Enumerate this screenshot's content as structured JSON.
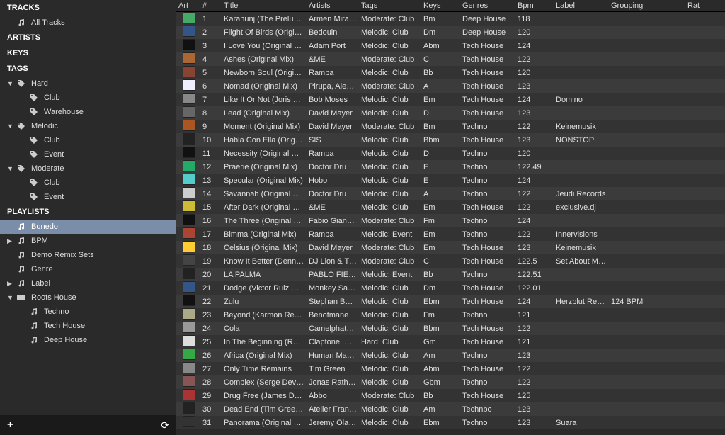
{
  "sidebar": {
    "sections": {
      "tracks": {
        "label": "TRACKS",
        "allTracks": "All Tracks"
      },
      "artists": {
        "label": "ARTISTS"
      },
      "keys": {
        "label": "KEYS"
      },
      "tags": {
        "label": "TAGS",
        "hard": {
          "label": "Hard",
          "club": "Club",
          "warehouse": "Warehouse"
        },
        "melodic": {
          "label": "Melodic",
          "club": "Club",
          "event": "Event"
        },
        "moderate": {
          "label": "Moderate",
          "club": "Club",
          "event": "Event"
        }
      },
      "playlists": {
        "label": "PLAYLISTS",
        "bonedo": "Bonedo",
        "bpm": "BPM",
        "demoRemix": "Demo Remix Sets",
        "genre": "Genre",
        "labelPL": "Label",
        "rootsHouse": {
          "label": "Roots House",
          "techno": "Techno",
          "techHouse": "Tech House",
          "deepHouse": "Deep House"
        }
      }
    }
  },
  "columns": {
    "art": "Art",
    "num": "#",
    "title": "Title",
    "artists": "Artists",
    "tags": "Tags",
    "keys": "Keys",
    "genres": "Genres",
    "bpm": "Bpm",
    "label": "Label",
    "grouping": "Grouping",
    "rat": "Rat"
  },
  "rows": [
    {
      "n": "1",
      "title": "Karahunj (The Prelude)",
      "artist": "Armen Mira…",
      "tag": "Moderate: Club",
      "key": "Bm",
      "genre": "Deep House",
      "bpm": "118",
      "label": "",
      "grouping": ""
    },
    {
      "n": "2",
      "title": "Flight Of Birds (Original…",
      "artist": "Bedouin",
      "tag": "Melodic: Club",
      "key": "Dm",
      "genre": "Deep House",
      "bpm": "120",
      "label": "",
      "grouping": ""
    },
    {
      "n": "3",
      "title": "I Love You (Original Mix)",
      "artist": "Adam Port",
      "tag": "Melodic: Club",
      "key": "Abm",
      "genre": "Tech House",
      "bpm": "124",
      "label": "",
      "grouping": ""
    },
    {
      "n": "4",
      "title": "Ashes (Original Mix)",
      "artist": "&ME",
      "tag": "Moderate: Club",
      "key": "C",
      "genre": "Tech House",
      "bpm": "122",
      "label": "",
      "grouping": ""
    },
    {
      "n": "5",
      "title": "Newborn Soul (Original…",
      "artist": "Rampa",
      "tag": "Melodic: Club",
      "key": "Bb",
      "genre": "Tech House",
      "bpm": "120",
      "label": "",
      "grouping": ""
    },
    {
      "n": "6",
      "title": "Nomad (Original Mix)",
      "artist": "Pirupa, Alex…",
      "tag": "Moderate: Club",
      "key": "A",
      "genre": "Tech House",
      "bpm": "123",
      "label": "",
      "grouping": ""
    },
    {
      "n": "7",
      "title": "Like It Or Not (Joris Voor…",
      "artist": "Bob Moses",
      "tag": "Melodic: Club",
      "key": "Em",
      "genre": "Tech House",
      "bpm": "124",
      "label": "Domino",
      "grouping": ""
    },
    {
      "n": "8",
      "title": "Lead (Original Mix)",
      "artist": "David Mayer",
      "tag": "Melodic: Club",
      "key": "D",
      "genre": "Tech House",
      "bpm": "123",
      "label": "",
      "grouping": ""
    },
    {
      "n": "9",
      "title": "Moment (Original Mix)",
      "artist": "David Mayer",
      "tag": "Moderate: Club",
      "key": "Bm",
      "genre": "Techno",
      "bpm": "122",
      "label": "Keinemusik",
      "grouping": ""
    },
    {
      "n": "10",
      "title": "Habla Con Ella (Original…",
      "artist": "SIS",
      "tag": "Melodic: Club",
      "key": "Bbm",
      "genre": "Tech House",
      "bpm": "123",
      "label": "NONSTOP",
      "grouping": ""
    },
    {
      "n": "11",
      "title": "Necessity (Original Mix)",
      "artist": "Rampa",
      "tag": "Melodic: Club",
      "key": "D",
      "genre": "Techno",
      "bpm": "120",
      "label": "",
      "grouping": ""
    },
    {
      "n": "12",
      "title": "Praerie (Original Mix)",
      "artist": "Doctor Dru",
      "tag": "Melodic: Club",
      "key": "E",
      "genre": "Techno",
      "bpm": "122.49",
      "label": "",
      "grouping": ""
    },
    {
      "n": "13",
      "title": "Specular (Original Mix)",
      "artist": "Hobo",
      "tag": "Melodic: Club",
      "key": "E",
      "genre": "Techno",
      "bpm": "124",
      "label": "",
      "grouping": ""
    },
    {
      "n": "14",
      "title": "Savannah (Original Mix)",
      "artist": "Doctor Dru",
      "tag": "Melodic: Club",
      "key": "A",
      "genre": "Techno",
      "bpm": "122",
      "label": "Jeudi Records",
      "grouping": ""
    },
    {
      "n": "15",
      "title": "After Dark (Original Mix)",
      "artist": "&ME",
      "tag": "Melodic: Club",
      "key": "Em",
      "genre": "Tech House",
      "bpm": "122",
      "label": "exclusive.dj",
      "grouping": ""
    },
    {
      "n": "16",
      "title": "The Three (Original Mix)",
      "artist": "Fabio Giannelli",
      "tag": "Moderate: Club",
      "key": "Fm",
      "genre": "Techno",
      "bpm": "124",
      "label": "",
      "grouping": ""
    },
    {
      "n": "17",
      "title": "Bimma (Original Mix)",
      "artist": "Rampa",
      "tag": "Melodic: Event",
      "key": "Em",
      "genre": "Techno",
      "bpm": "122",
      "label": "Innervisions",
      "grouping": ""
    },
    {
      "n": "18",
      "title": "Celsius (Original Mix)",
      "artist": "David Mayer",
      "tag": "Moderate: Club",
      "key": "Em",
      "genre": "Tech House",
      "bpm": "123",
      "label": "Keinemusik",
      "grouping": ""
    },
    {
      "n": "19",
      "title": "Know It Better (Dennis C…",
      "artist": "DJ Lion & Tr…",
      "tag": "Moderate: Club",
      "key": "C",
      "genre": "Tech House",
      "bpm": "122.5",
      "label": "Set About Mu…",
      "grouping": ""
    },
    {
      "n": "20",
      "title": "LA PALMA",
      "artist": "PABLO FIER…",
      "tag": "Melodic: Event",
      "key": "Bb",
      "genre": "Techno",
      "bpm": "122.51",
      "label": "",
      "grouping": ""
    },
    {
      "n": "21",
      "title": "Dodge (Victor Ruiz Remix)",
      "artist": "Monkey Safari",
      "tag": "Melodic: Club",
      "key": "Dm",
      "genre": "Tech House",
      "bpm": "122.01",
      "label": "",
      "grouping": ""
    },
    {
      "n": "22",
      "title": "Zulu",
      "artist": "Stephan Bo…",
      "tag": "Melodic: Club",
      "key": "Ebm",
      "genre": "Tech House",
      "bpm": "124",
      "label": "Herzblut Rec…",
      "grouping": "124 BPM"
    },
    {
      "n": "23",
      "title": "Beyond (Karmon Remix)",
      "artist": "Benotmane",
      "tag": "Melodic: Club",
      "key": "Fm",
      "genre": "Techno",
      "bpm": "121",
      "label": "",
      "grouping": ""
    },
    {
      "n": "24",
      "title": "Cola",
      "artist": "Camelphat…",
      "tag": "Melodic: Club",
      "key": "Bbm",
      "genre": "Tech House",
      "bpm": "122",
      "label": "",
      "grouping": ""
    },
    {
      "n": "25",
      "title": "In The Beginning (Raum…",
      "artist": "Claptone, N…",
      "tag": "Hard: Club",
      "key": "Gm",
      "genre": "Tech House",
      "bpm": "121",
      "label": "",
      "grouping": ""
    },
    {
      "n": "26",
      "title": "Africa (Original Mix)",
      "artist": "Human Mac…",
      "tag": "Melodic: Club",
      "key": "Am",
      "genre": "Techno",
      "bpm": "123",
      "label": "",
      "grouping": ""
    },
    {
      "n": "27",
      "title": "Only Time Remains",
      "artist": "Tim Green",
      "tag": "Melodic: Club",
      "key": "Abm",
      "genre": "Tech House",
      "bpm": "122",
      "label": "",
      "grouping": ""
    },
    {
      "n": "28",
      "title": "Complex (Serge Devant…",
      "artist": "Jonas Rath…",
      "tag": "Melodic: Club",
      "key": "Gbm",
      "genre": "Techno",
      "bpm": "122",
      "label": "",
      "grouping": ""
    },
    {
      "n": "29",
      "title": "Drug Free (James Dexte…",
      "artist": "Abbo",
      "tag": "Moderate: Club",
      "key": "Bb",
      "genre": "Tech House",
      "bpm": "125",
      "label": "",
      "grouping": ""
    },
    {
      "n": "30",
      "title": "Dead End (Tim Green R…",
      "artist": "Atelier Franc…",
      "tag": "Melodic: Club",
      "key": "Am",
      "genre": "Technbo",
      "bpm": "123",
      "label": "",
      "grouping": ""
    },
    {
      "n": "31",
      "title": "Panorama (Original Mix)",
      "artist": "Jeremy Ola…",
      "tag": "Melodic: Club",
      "key": "Ebm",
      "genre": "Techno",
      "bpm": "123",
      "label": "Suara",
      "grouping": ""
    }
  ]
}
